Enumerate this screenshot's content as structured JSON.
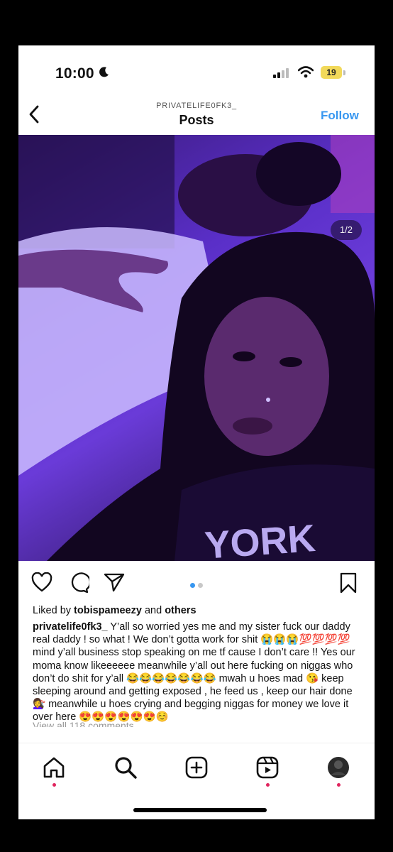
{
  "status_bar": {
    "time": "10:00",
    "battery": "19"
  },
  "header": {
    "username": "PRIVATELIFE0FK3_",
    "title": "Posts",
    "follow_label": "Follow"
  },
  "post": {
    "image_counter": "1/2",
    "photo_shirt_text": "YORK",
    "liked_prefix": "Liked by ",
    "liked_user": "tobispameezy",
    "liked_and": " and ",
    "liked_others": "others",
    "caption_user": "privatelife0fk3_",
    "caption_text": " Y’all so worried yes me and my sister fuck our daddy  real daddy ! so what ! We don’t gotta work for shit 😭😭😭💯💯💯💯 mind y’all business stop speaking on me tf cause I don’t care !! Yes our moma know likeeeeee meanwhile y’all out here fucking on niggas who don’t do shit for y’all 😂😂😂😂😂😂😂 mwah u hoes mad 😘 keep sleeping around and getting exposed , he feed us , keep our hair done 💇‍♀️ meanwhile u hoes crying and begging niggas for money we love it over here 😍😍😍😍😍😍☺️",
    "view_all": "View all 118 comments"
  },
  "icons": {
    "moon": "moon-icon",
    "signal": "signal-icon",
    "wifi": "wifi-icon",
    "back": "chevron-left-icon",
    "like": "heart-icon",
    "comment": "comment-icon",
    "share": "send-icon",
    "save": "bookmark-icon",
    "nav": [
      "home-icon",
      "search-icon",
      "create-icon",
      "reels-icon",
      "profile-avatar"
    ]
  },
  "colors": {
    "accent": "#3897f0",
    "notification": "#e0245e",
    "photo_tint": "#5a2fc8"
  }
}
